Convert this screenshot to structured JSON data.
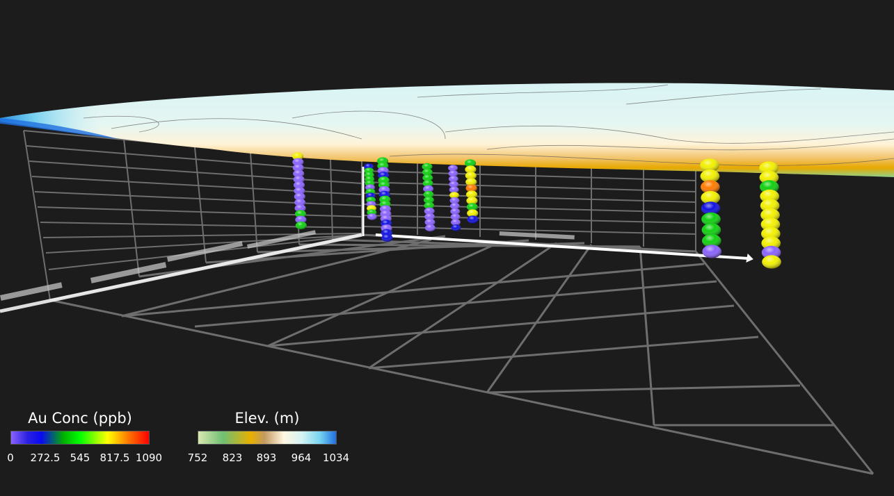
{
  "legends": {
    "au": {
      "title": "Au Conc (ppb)",
      "ticks": [
        "0",
        "272.5",
        "545",
        "817.5",
        "1090"
      ]
    },
    "elev": {
      "title": "Elev. (m)",
      "ticks": [
        "752",
        "823",
        "893",
        "964",
        "1034"
      ]
    }
  },
  "colors": {
    "background": "#1c1c1c",
    "grid": "#6e6e6e",
    "axis": "#ffffff",
    "au_scale": [
      "#8a63ff",
      "#0a0af0",
      "#00ff00",
      "#ffff00",
      "#ff0000"
    ],
    "elev_scale": [
      "#d9e8b0",
      "#6fbf73",
      "#e8b000",
      "#fff7e0",
      "#7ad6f0",
      "#1f6fe0"
    ]
  },
  "drillholes": [
    {
      "samples": [
        "yellow",
        "purple",
        "purple",
        "purple",
        "purple",
        "purple",
        "purple",
        "purple",
        "purple",
        "purple",
        "green",
        "purple",
        "green"
      ]
    },
    {
      "samples": [
        "blue",
        "green",
        "green",
        "green",
        "green",
        "purple",
        "green",
        "blue",
        "green",
        "purple",
        "yellow",
        "green",
        "purple"
      ]
    },
    {
      "samples": [
        "green",
        "green",
        "purple",
        "blue",
        "green",
        "green",
        "purple",
        "blue",
        "green",
        "green",
        "purple",
        "purple",
        "purple",
        "blue",
        "purple",
        "blue",
        "blue"
      ]
    },
    {
      "samples": [
        "green",
        "green",
        "green",
        "green",
        "purple",
        "green",
        "green",
        "green",
        "purple",
        "purple",
        "purple",
        "purple"
      ]
    },
    {
      "samples": [
        "purple",
        "purple",
        "purple",
        "purple",
        "purple",
        "yellow",
        "purple",
        "purple",
        "purple",
        "purple",
        "purple",
        "blue"
      ]
    },
    {
      "samples": [
        "green",
        "yellow",
        "yellow",
        "yellow",
        "orange",
        "yellow",
        "yellow",
        "green",
        "yellow",
        "blue"
      ]
    },
    {
      "samples": [
        "yellow",
        "yellow",
        "orange",
        "yellow",
        "blue",
        "green",
        "green",
        "green",
        "purple"
      ]
    },
    {
      "samples": [
        "yellow",
        "yellow",
        "green",
        "yellow",
        "yellow",
        "yellow",
        "yellow",
        "yellow",
        "yellow",
        "purple",
        "yellow"
      ]
    }
  ]
}
